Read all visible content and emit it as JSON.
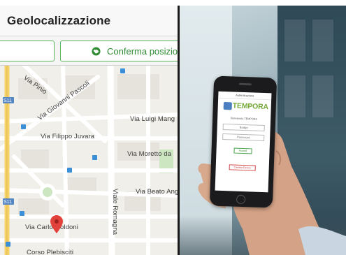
{
  "left_app": {
    "title": "Geolocalizzazione",
    "address_input": {
      "value": "",
      "placeholder": ""
    },
    "confirm_button": {
      "label": "Conferma posizione",
      "icon": "globe-icon"
    },
    "map": {
      "streets": [
        "Via Pinio",
        "Via Giovanni Pascoli",
        "Via Filippo Juvara",
        "Via Luigi Mang",
        "Via Moretto da",
        "Viale Romagna",
        "Via Beato Ang",
        "Via Carlo Goldoni",
        "Corso Plebisciti"
      ],
      "highway_shields": [
        "S11",
        "S11"
      ],
      "pin": "location-pin-icon"
    }
  },
  "phone_app": {
    "header_text": "Autenticazione",
    "brand": "TEMPORA",
    "welcome_text": "Benvenuto TEMPORA",
    "badge_placeholder": "Badge",
    "password_placeholder": "Password",
    "login_label": "Accedi",
    "change_device_label": "Cambia Device"
  },
  "colors": {
    "accent_green": "#59b35a",
    "brand_green": "#76a93a",
    "brand_blue": "#4b7fc0",
    "map_bg": "#f1efe9",
    "major_road": "#f7d36b"
  }
}
